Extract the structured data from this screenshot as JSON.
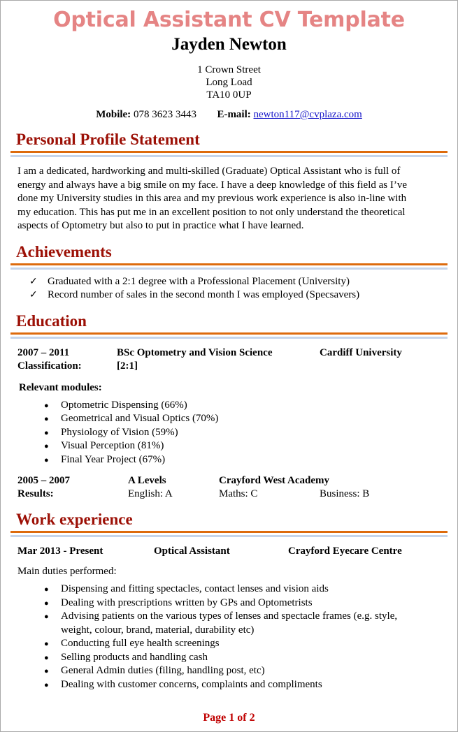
{
  "colors": {
    "title": "#e58484",
    "heading": "#9c1006",
    "rule_orange": "#dd6b0d",
    "rule_blue": "#c6d5ea",
    "link": "#1414c8",
    "footer": "#c00000"
  },
  "header": {
    "document_title": "Optical Assistant CV Template",
    "name": "Jayden Newton",
    "address_line1": "1 Crown Street",
    "address_line2": "Long Load",
    "address_line3": "TA10 0UP",
    "mobile_label": "Mobile:",
    "mobile_value": "078 3623 3443",
    "email_label": "E-mail:",
    "email_value": "newton117@cvplaza.com"
  },
  "profile": {
    "heading": "Personal Profile Statement",
    "text": "I am a dedicated, hardworking and multi-skilled (Graduate) Optical Assistant who is full of energy and always have a big smile on my face. I have a deep knowledge of this field as I’ve done my University studies in this area and my previous work experience is also in-line with my education. This has put me in an excellent position to not only understand the theoretical aspects of Optometry but also to put in practice what I have learned."
  },
  "achievements": {
    "heading": "Achievements",
    "items": [
      "Graduated with a 2:1 degree with a Professional Placement (University)",
      "Record number of sales in the second month I was employed (Specsavers)"
    ]
  },
  "education": {
    "heading": "Education",
    "entry1": {
      "years": "2007 – 2011",
      "qualification": "BSc Optometry and Vision Science",
      "institution": "Cardiff University",
      "classification_label": "Classification:",
      "classification_value": "[2:1]"
    },
    "modules_label": "Relevant modules:",
    "modules": [
      "Optometric Dispensing (66%)",
      "Geometrical and Visual Optics (70%)",
      "Physiology of Vision (59%)",
      "Visual Perception (81%)",
      "Final Year Project (67%)"
    ],
    "entry2": {
      "years": "2005 – 2007",
      "qualification": "A Levels",
      "institution": "Crayford West Academy",
      "results_label": "Results:",
      "result1": "English: A",
      "result2": "Maths: C",
      "result3": "Business: B"
    }
  },
  "work": {
    "heading": "Work experience",
    "entry1": {
      "dates": "Mar 2013 - Present",
      "role": "Optical Assistant",
      "employer": "Crayford Eyecare Centre",
      "duties_label": "Main duties performed:",
      "duties": [
        "Dispensing and fitting spectacles, contact lenses and vision aids",
        "Dealing with prescriptions written by GPs and Optometrists",
        "Advising patients on the various types of lenses and spectacle frames (e.g. style, weight, colour, brand, material, durability etc)",
        "Conducting full eye health screenings",
        "Selling products and handling cash",
        "General Admin duties (filing, handling post, etc)",
        "Dealing with customer concerns, complaints and compliments"
      ]
    }
  },
  "footer": {
    "page_label": "Page 1 of 2"
  }
}
